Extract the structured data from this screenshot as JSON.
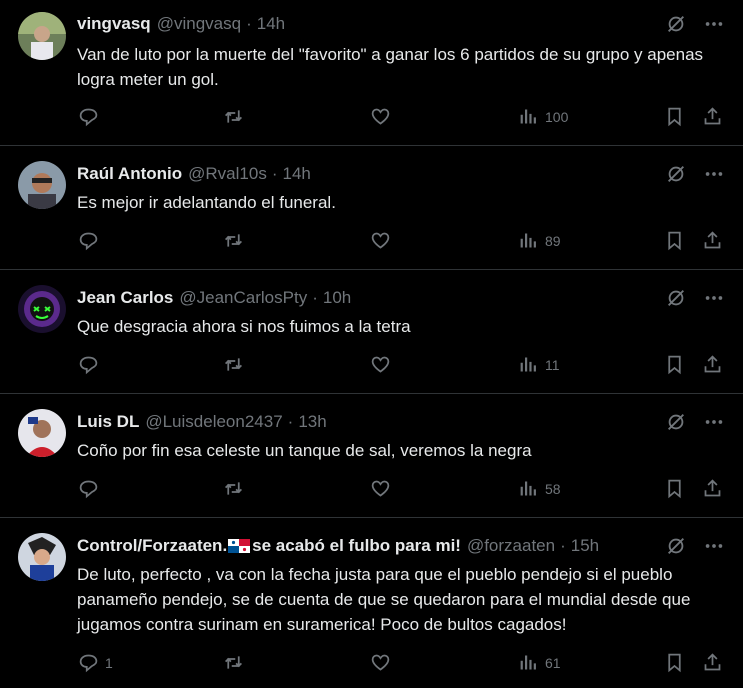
{
  "tweets": [
    {
      "name": "vingvasq",
      "handle": "@vingvasq",
      "time": "14h",
      "text": "Van de luto por la muerte del \"favorito\" a ganar los 6 partidos de su grupo y apenas logra meter un gol.",
      "replies": "",
      "views": "100",
      "avatar_color": "#7a6f63"
    },
    {
      "name": "Raúl Antonio",
      "handle": "@Rval10s",
      "time": "14h",
      "text": "Es mejor ir adelantando el funeral.",
      "replies": "",
      "views": "89",
      "avatar_color": "#5a6a7a"
    },
    {
      "name": "Jean Carlos",
      "handle": "@JeanCarlosPty",
      "time": "10h",
      "text": "Que desgracia ahora si nos fuimos a la tetra",
      "replies": "",
      "views": "11",
      "avatar_color": "#3b1f5e"
    },
    {
      "name": "Luis DL",
      "handle": "@Luisdeleon2437",
      "time": "13h",
      "text": "Coño por fin esa celeste un tanque de sal, veremos la negra",
      "replies": "",
      "views": "58",
      "avatar_color": "#c9c9d2"
    },
    {
      "name": "Control/Forzaaten.",
      "name_suffix": "se acabó el fulbo para mi!",
      "handle": "@forzaaten",
      "time": "15h",
      "text": "De luto, perfecto , va con la fecha justa para que el pueblo pendejo si el pueblo panameño pendejo, se de cuenta de que se quedaron para el mundial desde que jugamos contra surinam en suramerica! Poco de bultos cagados!",
      "replies": "1",
      "views": "61",
      "avatar_color": "#2a3550"
    }
  ],
  "separator": "·",
  "colors": {
    "text": "#e7e9ea",
    "muted": "#71767b",
    "border": "#2f3336",
    "background": "#000000"
  },
  "icons": [
    "reply-icon",
    "retweet-icon",
    "like-icon",
    "views-icon",
    "bookmark-icon",
    "share-icon",
    "grok-icon",
    "more-icon"
  ]
}
